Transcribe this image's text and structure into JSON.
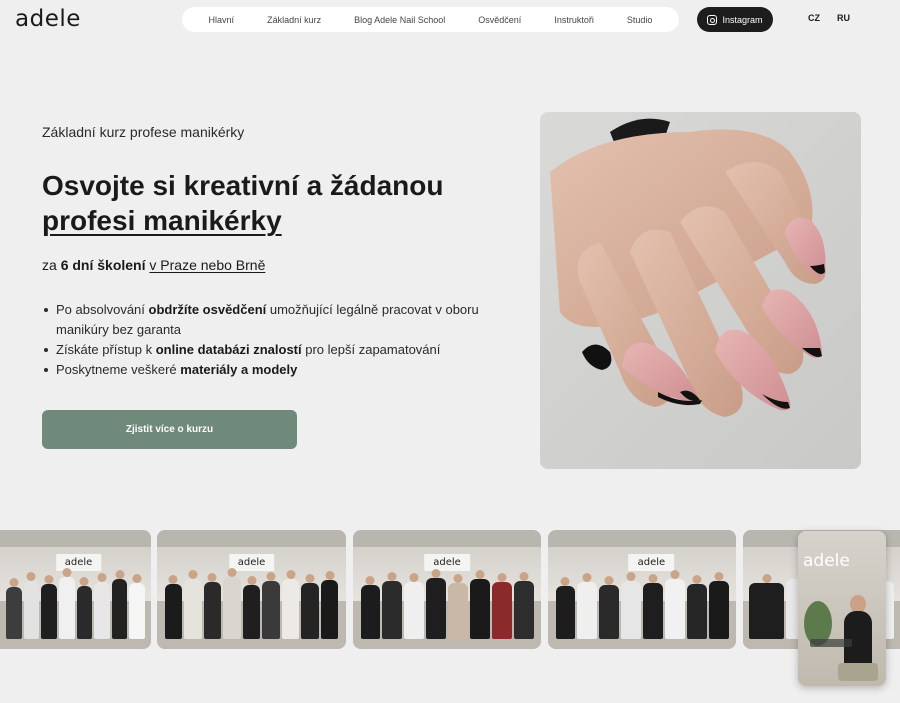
{
  "header": {
    "logo": "adele",
    "nav": [
      "Hlavní",
      "Základní kurz",
      "Blog Adele Nail School",
      "Osvědčení",
      "Instruktoři",
      "Studio"
    ],
    "instagram_label": "Instagram",
    "languages": [
      "CZ",
      "RU"
    ]
  },
  "hero": {
    "eyebrow": "Základní kurz profese manikérky",
    "headline_line1": "Osvojte si kreativní a žádanou",
    "headline_line2": "profesi manikérky",
    "sub_prefix": "za ",
    "sub_bold": "6 dní školení",
    "sub_link": "v Praze nebo Brně",
    "bullets": [
      {
        "before": "Po absolvování ",
        "bold": "obdržíte osvědčení",
        "after": " umožňující legálně pracovat v oboru manikúry bez garanta"
      },
      {
        "before": "Získáte přístup k ",
        "bold": "online databázi znalostí",
        "after": " pro lepší zapamatování"
      },
      {
        "before": "Poskytneme veškeré ",
        "bold": "materiály a modely",
        "after": ""
      }
    ],
    "cta_label": "Zjistit více o kurzu"
  },
  "gallery": {
    "brand_sign": "adele"
  },
  "video_card": {
    "logo": "adele"
  }
}
